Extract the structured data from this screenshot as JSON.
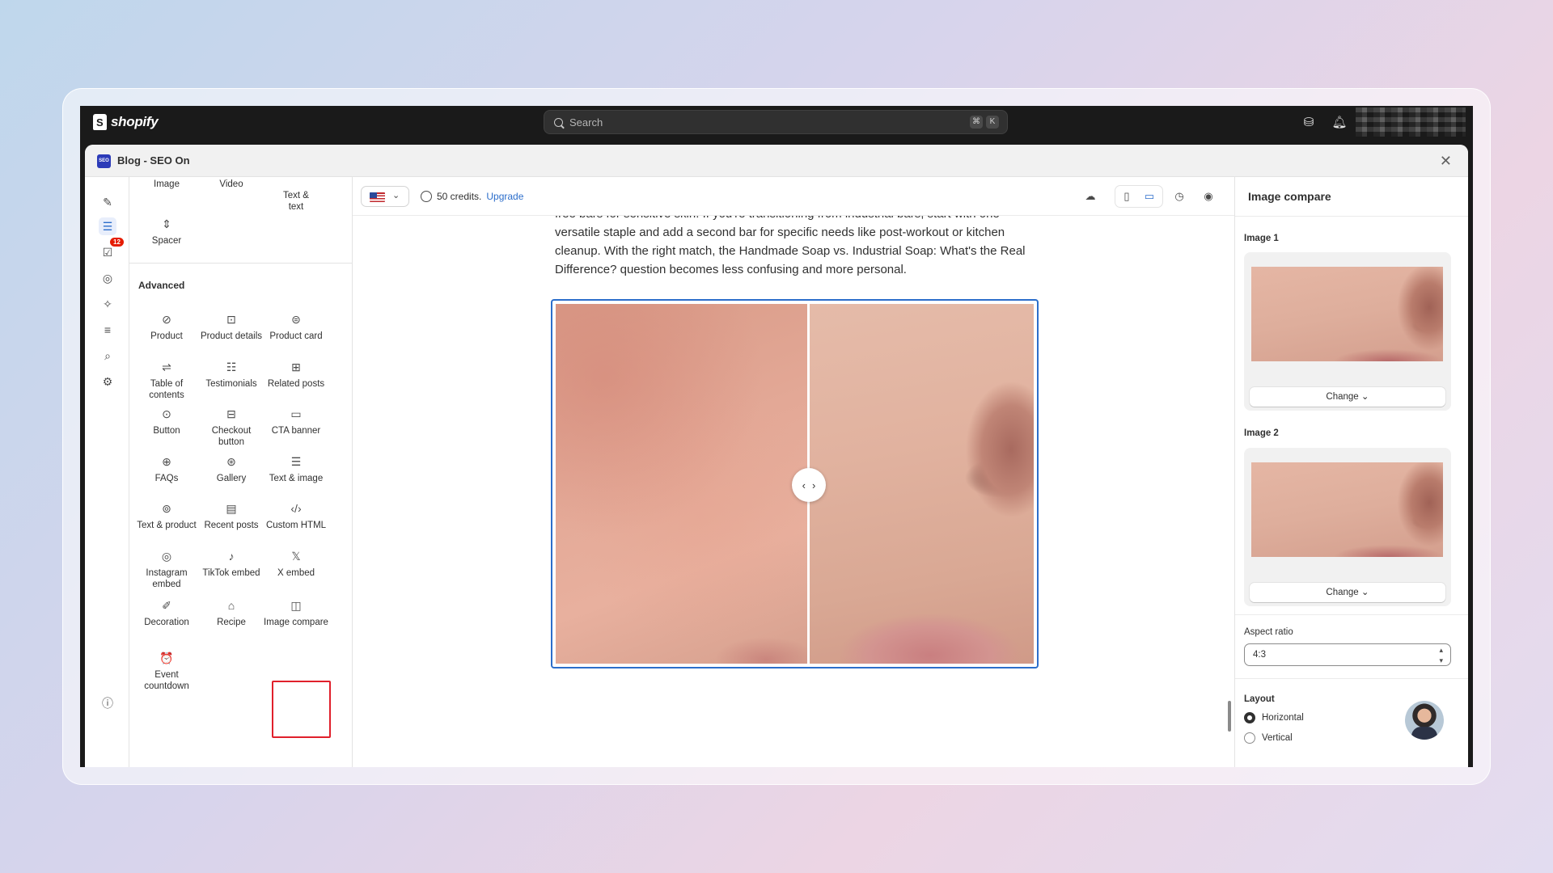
{
  "topbar": {
    "logo_text": "shopify",
    "search_placeholder": "Search",
    "shortcut_keys": [
      "⌘",
      "K"
    ],
    "icons": [
      "store-icon",
      "bell-icon"
    ]
  },
  "window": {
    "logo_text": "SEO",
    "title": "Blog - SEO On"
  },
  "rail": {
    "badge_count": "12",
    "icons": [
      "edit-icon",
      "blocks-icon",
      "tasks-icon",
      "globe-icon",
      "sparkle-icon",
      "outline-icon",
      "search-seo-icon",
      "settings-icon",
      "help-icon"
    ]
  },
  "library": {
    "basic_items": [
      {
        "label": "Image",
        "icon": "image-icon"
      },
      {
        "label": "Video",
        "icon": "video-icon"
      },
      {
        "label": "Text &\ntext",
        "icon": "text-text-icon"
      },
      {
        "label": "Spacer",
        "icon": "spacer-icon"
      }
    ],
    "section_title": "Advanced",
    "advanced_items": [
      {
        "label": "Product",
        "icon": "tag-icon"
      },
      {
        "label": "Product details",
        "icon": "product-details-icon"
      },
      {
        "label": "Product card",
        "icon": "product-card-icon"
      },
      {
        "label": "Table of contents",
        "icon": "toc-icon"
      },
      {
        "label": "Testimonials",
        "icon": "testimonials-icon"
      },
      {
        "label": "Related posts",
        "icon": "related-posts-icon"
      },
      {
        "label": "Button",
        "icon": "button-icon"
      },
      {
        "label": "Checkout button",
        "icon": "checkout-icon"
      },
      {
        "label": "CTA banner",
        "icon": "cta-icon"
      },
      {
        "label": "FAQs",
        "icon": "faq-icon"
      },
      {
        "label": "Gallery",
        "icon": "gallery-icon"
      },
      {
        "label": "Text & image",
        "icon": "text-image-icon"
      },
      {
        "label": "Text & product",
        "icon": "text-product-icon"
      },
      {
        "label": "Recent posts",
        "icon": "recent-posts-icon"
      },
      {
        "label": "Custom HTML",
        "icon": "code-icon"
      },
      {
        "label": "Instagram embed",
        "icon": "instagram-icon"
      },
      {
        "label": "TikTok embed",
        "icon": "tiktok-icon"
      },
      {
        "label": "X embed",
        "icon": "x-icon"
      },
      {
        "label": "Decoration",
        "icon": "brush-icon"
      },
      {
        "label": "Recipe",
        "icon": "recipe-icon"
      },
      {
        "label": "Image compare",
        "icon": "image-compare-icon"
      },
      {
        "label": "Event countdown",
        "icon": "alarm-icon"
      }
    ]
  },
  "canvas": {
    "credits_text": "50 credits.",
    "upgrade_label": "Upgrade",
    "article_text": "free bars for sensitive skin. If you're transitioning from industrial bars, start with one versatile staple and add a second bar for specific needs like post-workout or kitchen cleanup. With the right match, the Handmade Soap vs. Industrial Soap: What's the Real Difference? question becomes less confusing and more personal."
  },
  "panel": {
    "title": "Image compare",
    "image1_label": "Image 1",
    "image2_label": "Image 2",
    "change_label": "Change",
    "aspect_ratio_label": "Aspect ratio",
    "aspect_ratio_value": "4:3",
    "layout_label": "Layout",
    "layout_options": [
      "Horizontal",
      "Vertical"
    ],
    "layout_selected": "Horizontal"
  },
  "colors": {
    "accent": "#2c6ecb",
    "highlight": "#e0202b",
    "topbar": "#1a1a1a"
  }
}
